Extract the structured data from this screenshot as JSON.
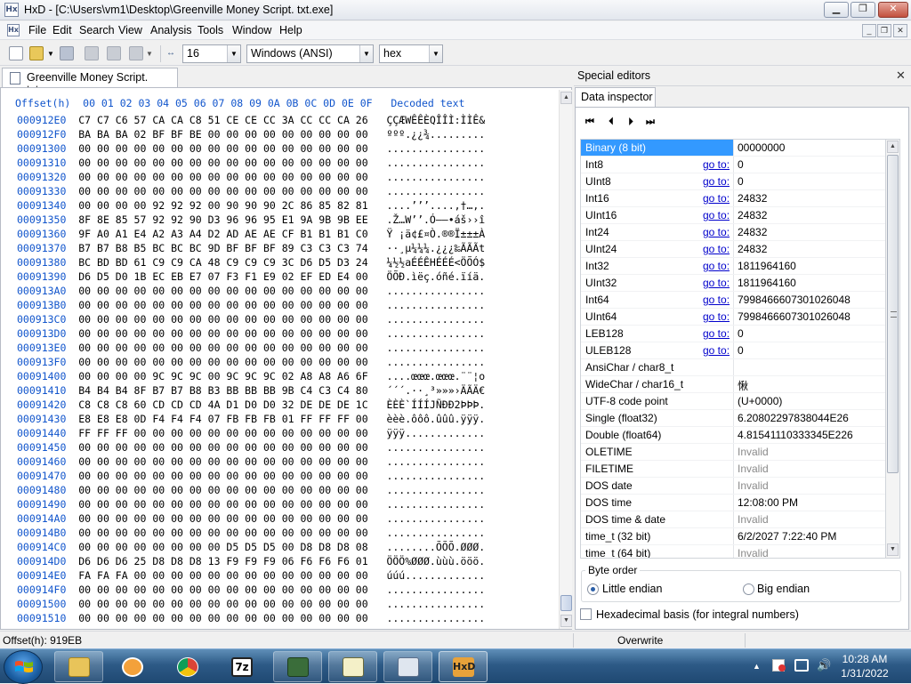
{
  "window": {
    "title": "HxD - [C:\\Users\\vm1\\Desktop\\Greenville Money Script. txt.exe]",
    "minimize_icon": "minimize-icon",
    "maximize_icon": "restore-icon",
    "close_icon": "close-icon"
  },
  "menu": {
    "items": [
      "File",
      "Edit",
      "Search",
      "View",
      "Analysis",
      "Tools",
      "Window",
      "Help"
    ]
  },
  "toolbar": {
    "bytes_per_row": "16",
    "charset": "Windows (ANSI)",
    "offset_base": "hex"
  },
  "document": {
    "tab_label": "Greenville Money Script. txt.exe",
    "header": "Offset(h)  00 01 02 03 04 05 06 07 08 09 0A 0B 0C 0D 0E 0F   Decoded text",
    "rows": [
      {
        "offset": "000912E0",
        "bytes": "C7 C7 C6 57 CA CA C8 51 CE CE CC 3A CC CC CA 26",
        "text": "ÇÇÆWÊÊÈQÎÎÌ:ÌÌÊ&"
      },
      {
        "offset": "000912F0",
        "bytes": "BA BA BA 02 BF BF BE 00 00 00 00 00 00 00 00 00",
        "text": "ººº.¿¿¾........."
      },
      {
        "offset": "00091300",
        "bytes": "00 00 00 00 00 00 00 00 00 00 00 00 00 00 00 00",
        "text": "................"
      },
      {
        "offset": "00091310",
        "bytes": "00 00 00 00 00 00 00 00 00 00 00 00 00 00 00 00",
        "text": "................"
      },
      {
        "offset": "00091320",
        "bytes": "00 00 00 00 00 00 00 00 00 00 00 00 00 00 00 00",
        "text": "................"
      },
      {
        "offset": "00091330",
        "bytes": "00 00 00 00 00 00 00 00 00 00 00 00 00 00 00 00",
        "text": "................"
      },
      {
        "offset": "00091340",
        "bytes": "00 00 00 00 92 92 92 00 90 90 90 2C 86 85 82 81",
        "text": "....’’’....,†…‚."
      },
      {
        "offset": "00091350",
        "bytes": "8F 8E 85 57 92 92 90 D3 96 96 95 E1 9A 9B 9B EE",
        "text": ".Ž…W’’.Ó––•áš››î"
      },
      {
        "offset": "00091360",
        "bytes": "9F A0 A1 E4 A2 A3 A4 D2 AD AE AE CF B1 B1 B1 C0",
        "text": "Ÿ ¡ä¢£¤Ò.®®Ï±±±À"
      },
      {
        "offset": "00091370",
        "bytes": "B7 B7 B8 B5 BC BC BC 9D BF BF BF 89 C3 C3 C3 74",
        "text": "··¸µ¼¼¼.¿¿¿‰ÃÃÃt"
      },
      {
        "offset": "00091380",
        "bytes": "BC BD BD 61 C9 C9 CA 48 C9 C9 C9 3C D6 D5 D3 24",
        "text": "¼½½aÉÉÊHÉÉÉ<ÖÕÓ$"
      },
      {
        "offset": "00091390",
        "bytes": "D6 D5 D0 1B EC EB E7 07 F3 F1 E9 02 EF ED E4 00",
        "text": "ÖÕÐ.ìëç.óñé.ïíä."
      },
      {
        "offset": "000913A0",
        "bytes": "00 00 00 00 00 00 00 00 00 00 00 00 00 00 00 00",
        "text": "................"
      },
      {
        "offset": "000913B0",
        "bytes": "00 00 00 00 00 00 00 00 00 00 00 00 00 00 00 00",
        "text": "................"
      },
      {
        "offset": "000913C0",
        "bytes": "00 00 00 00 00 00 00 00 00 00 00 00 00 00 00 00",
        "text": "................"
      },
      {
        "offset": "000913D0",
        "bytes": "00 00 00 00 00 00 00 00 00 00 00 00 00 00 00 00",
        "text": "................"
      },
      {
        "offset": "000913E0",
        "bytes": "00 00 00 00 00 00 00 00 00 00 00 00 00 00 00 00",
        "text": "................"
      },
      {
        "offset": "000913F0",
        "bytes": "00 00 00 00 00 00 00 00 00 00 00 00 00 00 00 00",
        "text": "................"
      },
      {
        "offset": "00091400",
        "bytes": "00 00 00 00 9C 9C 9C 00 9C 9C 9C 02 A8 A8 A6 6F",
        "text": "....œœœ.œœœ.¨¨¦o"
      },
      {
        "offset": "00091410",
        "bytes": "B4 B4 B4 8F B7 B7 B8 B3 BB BB BB 9B C4 C3 C4 80",
        "text": "´´´.··¸³»»»›ÄÃÄ€"
      },
      {
        "offset": "00091420",
        "bytes": "C8 C8 C8 60 CD CD CD 4A D1 D0 D0 32 DE DE DE 1C",
        "text": "ÈÈÈ`ÍÍÍJÑÐÐ2ÞÞÞ."
      },
      {
        "offset": "00091430",
        "bytes": "E8 E8 E8 0D F4 F4 F4 07 FB FB FB 01 FF FF FF 00",
        "text": "èèè.ôôô.ûûû.ÿÿÿ."
      },
      {
        "offset": "00091440",
        "bytes": "FF FF FF 00 00 00 00 00 00 00 00 00 00 00 00 00",
        "text": "ÿÿÿ............."
      },
      {
        "offset": "00091450",
        "bytes": "00 00 00 00 00 00 00 00 00 00 00 00 00 00 00 00",
        "text": "................"
      },
      {
        "offset": "00091460",
        "bytes": "00 00 00 00 00 00 00 00 00 00 00 00 00 00 00 00",
        "text": "................"
      },
      {
        "offset": "00091470",
        "bytes": "00 00 00 00 00 00 00 00 00 00 00 00 00 00 00 00",
        "text": "................"
      },
      {
        "offset": "00091480",
        "bytes": "00 00 00 00 00 00 00 00 00 00 00 00 00 00 00 00",
        "text": "................"
      },
      {
        "offset": "00091490",
        "bytes": "00 00 00 00 00 00 00 00 00 00 00 00 00 00 00 00",
        "text": "................"
      },
      {
        "offset": "000914A0",
        "bytes": "00 00 00 00 00 00 00 00 00 00 00 00 00 00 00 00",
        "text": "................"
      },
      {
        "offset": "000914B0",
        "bytes": "00 00 00 00 00 00 00 00 00 00 00 00 00 00 00 00",
        "text": "................"
      },
      {
        "offset": "000914C0",
        "bytes": "00 00 00 00 00 00 00 00 D5 D5 D5 00 D8 D8 D8 08",
        "text": "........ÕÕÕ.ØØØ."
      },
      {
        "offset": "000914D0",
        "bytes": "D6 D6 D6 25 D8 D8 D8 13 F9 F9 F9 06 F6 F6 F6 01",
        "text": "ÖÖÖ%ØØØ.ùùù.ööö."
      },
      {
        "offset": "000914E0",
        "bytes": "FA FA FA 00 00 00 00 00 00 00 00 00 00 00 00 00",
        "text": "úúú............."
      },
      {
        "offset": "000914F0",
        "bytes": "00 00 00 00 00 00 00 00 00 00 00 00 00 00 00 00",
        "text": "................"
      },
      {
        "offset": "00091500",
        "bytes": "00 00 00 00 00 00 00 00 00 00 00 00 00 00 00 00",
        "text": "................"
      },
      {
        "offset": "00091510",
        "bytes": "00 00 00 00 00 00 00 00 00 00 00 00 00 00 00 00",
        "text": "................"
      }
    ]
  },
  "special_editors": {
    "title": "Special editors",
    "tab": "Data inspector",
    "nav_icons": [
      "first-icon",
      "previous-icon",
      "next-icon",
      "last-icon"
    ],
    "goto_label": "go to:",
    "fields": [
      {
        "name": "Binary (8 bit)",
        "value": "00000000",
        "goto": false,
        "invalid": false,
        "selected": true
      },
      {
        "name": "Int8",
        "value": "0",
        "goto": true,
        "invalid": false
      },
      {
        "name": "UInt8",
        "value": "0",
        "goto": true,
        "invalid": false
      },
      {
        "name": "Int16",
        "value": "24832",
        "goto": true,
        "invalid": false
      },
      {
        "name": "UInt16",
        "value": "24832",
        "goto": true,
        "invalid": false
      },
      {
        "name": "Int24",
        "value": "24832",
        "goto": true,
        "invalid": false
      },
      {
        "name": "UInt24",
        "value": "24832",
        "goto": true,
        "invalid": false
      },
      {
        "name": "Int32",
        "value": "1811964160",
        "goto": true,
        "invalid": false
      },
      {
        "name": "UInt32",
        "value": "1811964160",
        "goto": true,
        "invalid": false
      },
      {
        "name": "Int64",
        "value": "7998466607301026048",
        "goto": true,
        "invalid": false
      },
      {
        "name": "UInt64",
        "value": "7998466607301026048",
        "goto": true,
        "invalid": false
      },
      {
        "name": "LEB128",
        "value": "0",
        "goto": true,
        "invalid": false
      },
      {
        "name": "ULEB128",
        "value": "0",
        "goto": true,
        "invalid": false
      },
      {
        "name": "AnsiChar / char8_t",
        "value": "",
        "goto": false,
        "invalid": false
      },
      {
        "name": "WideChar / char16_t",
        "value": "愀",
        "goto": false,
        "invalid": false
      },
      {
        "name": "UTF-8 code point",
        "value": " (U+0000)",
        "goto": false,
        "invalid": false
      },
      {
        "name": "Single (float32)",
        "value": "6.20802297838044E26",
        "goto": false,
        "invalid": false
      },
      {
        "name": "Double (float64)",
        "value": "4.81541110333345E226",
        "goto": false,
        "invalid": false
      },
      {
        "name": "OLETIME",
        "value": "Invalid",
        "goto": false,
        "invalid": true
      },
      {
        "name": "FILETIME",
        "value": "Invalid",
        "goto": false,
        "invalid": true
      },
      {
        "name": "DOS date",
        "value": "Invalid",
        "goto": false,
        "invalid": true
      },
      {
        "name": "DOS time",
        "value": "12:08:00 PM",
        "goto": false,
        "invalid": false
      },
      {
        "name": "DOS time & date",
        "value": "Invalid",
        "goto": false,
        "invalid": true
      },
      {
        "name": "time_t (32 bit)",
        "value": "6/2/2027 7:22:40 PM",
        "goto": false,
        "invalid": false
      },
      {
        "name": "time_t (64 bit)",
        "value": "Invalid",
        "goto": false,
        "invalid": true
      }
    ],
    "byte_order_label": "Byte order",
    "little_endian": "Little endian",
    "big_endian": "Big endian",
    "selected_byte_order": "little",
    "hex_basis_label": "Hexadecimal basis (for integral numbers)",
    "hex_basis_checked": false
  },
  "status": {
    "offset": "Offset(h): 919EB",
    "mode": "Overwrite"
  },
  "taskbar": {
    "apps": [
      "explorer-icon",
      "media-player-icon",
      "chrome-icon",
      "7zip-icon",
      "network-monitor-icon",
      "notepad-icon",
      "form-window-icon",
      "hxd-icon"
    ],
    "time": "10:28 AM",
    "date": "1/31/2022"
  },
  "colors": {
    "offset_blue": "#1155cc",
    "selection": "#3399ff",
    "link": "#0000cc"
  }
}
